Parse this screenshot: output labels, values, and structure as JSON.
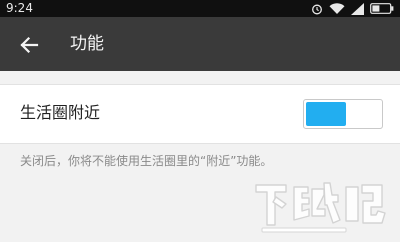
{
  "status_bar": {
    "time": "9:24",
    "icons": [
      "alarm-icon",
      "wifi-icon",
      "signal-icon",
      "battery-icon"
    ]
  },
  "app_bar": {
    "back_icon": "back-arrow-icon",
    "title": "功能"
  },
  "settings": {
    "nearby_row": {
      "label": "生活圈附近",
      "toggle_state": "on"
    },
    "help_text": "关闭后，你将不能使用生活圈里的“附近”功能。"
  },
  "colors": {
    "status_bar": "#101010",
    "app_bar": "#3a3a3a",
    "background": "#f2f2f2",
    "toggle_on": "#22aef0"
  },
  "watermark": {
    "logo_text": "下载吧",
    "sub_text": "www.xiazaiba.com"
  }
}
